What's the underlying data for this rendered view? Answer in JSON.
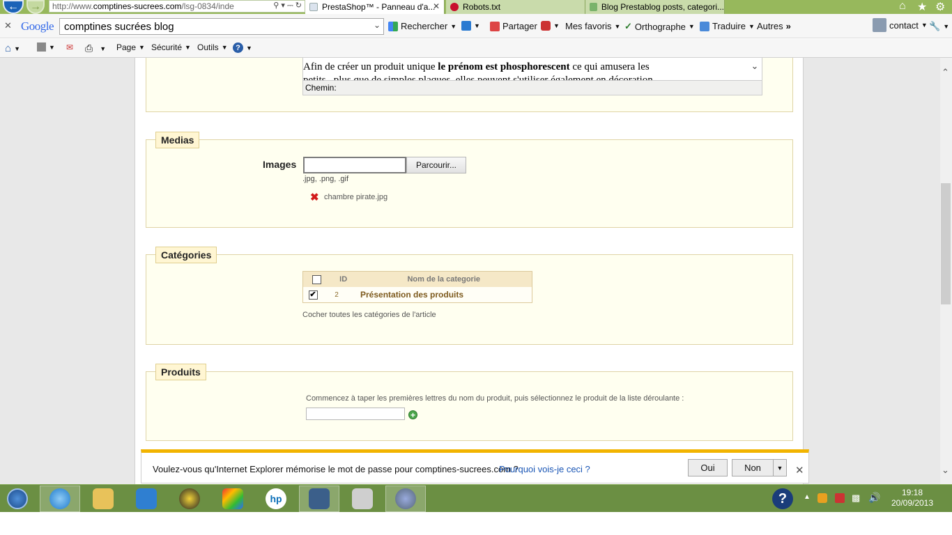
{
  "browser": {
    "address": {
      "prefix": "http://www.",
      "host": "comptines-sucrees.com",
      "path": "/lsg-0834/inde"
    },
    "tabs": [
      {
        "label": "PrestaShop™ - Panneau d'a..."
      },
      {
        "label": "Robots.txt"
      },
      {
        "label": "Blog Prestablog posts, categori..."
      }
    ]
  },
  "google_toolbar": {
    "logo": "Google",
    "search_value": "comptines sucrées blog",
    "rechercher": "Rechercher",
    "partager": "Partager",
    "mes_favoris": "Mes favoris",
    "orthographe": "Orthographe",
    "traduire": "Traduire",
    "autres": "Autres",
    "account": "contact"
  },
  "command_bar": {
    "page": "Page",
    "securite": "Sécurité",
    "outils": "Outils"
  },
  "editor": {
    "line1_before": "Afin de créer un produit unique ",
    "line1_bold": "le prénom est phosphorescent",
    "line1_after": " ce qui amusera les",
    "line2": "petits , plus que de simples plaques, elles peuvent s'utiliser également en décoration",
    "path_label": "Chemin:"
  },
  "medias": {
    "legend": "Medias",
    "images_label": "Images",
    "browse_label": "Parcourir...",
    "formats": ".jpg, .png, .gif",
    "file_name": "chambre pirate.jpg"
  },
  "categories": {
    "legend": "Catégories",
    "col_id": "ID",
    "col_name": "Nom de la categorie",
    "rows": [
      {
        "id": "2",
        "name": "Présentation des produits",
        "checked": true
      }
    ],
    "hint": "Cocher toutes les catégories de l'article"
  },
  "produits": {
    "legend": "Produits",
    "hint": "Commencez à taper les premières lettres du nom du produit, puis sélectionnez le produit de la liste déroulante :"
  },
  "notification": {
    "message": "Voulez-vous qu'Internet Explorer mémorise le mot de passe pour comptines-sucrees.com ?",
    "link": "Pourquoi vois-je ceci ?",
    "yes": "Oui",
    "no": "Non"
  },
  "taskbar": {
    "time": "19:18",
    "date": "20/09/2013"
  },
  "colors": {
    "tabbar": "#97b85c",
    "taskbar": "#6b8f43",
    "fieldset_bg": "#fffff0",
    "legend_bg": "#fff6d3",
    "link": "#1a56b5",
    "notif_accent": "#f2b400"
  }
}
